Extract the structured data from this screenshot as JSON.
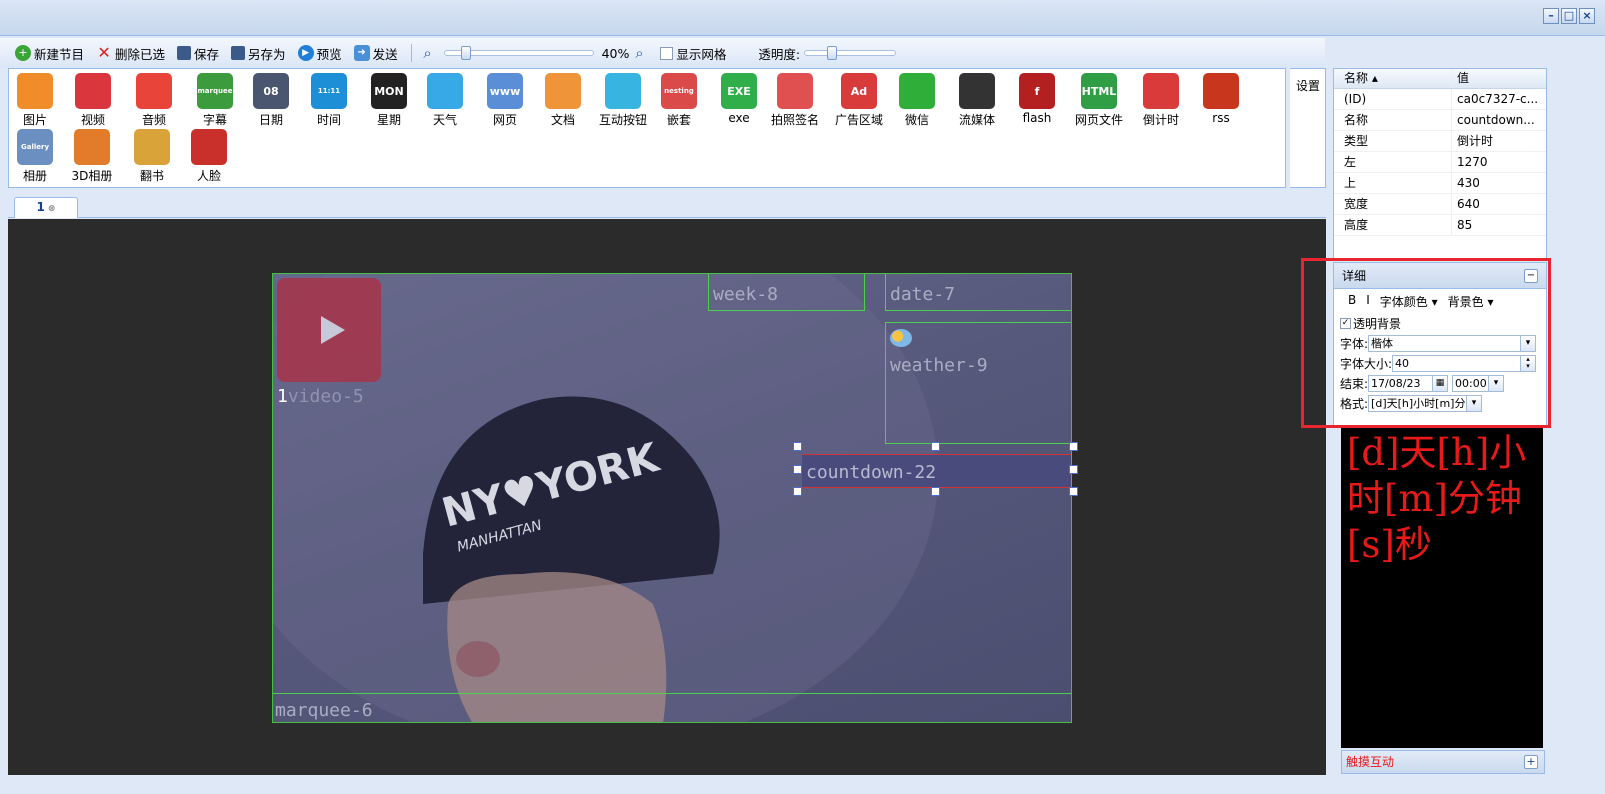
{
  "toolbar": {
    "new_program": "新建节目",
    "delete_selected": "删除已选",
    "save": "保存",
    "save_as": "另存为",
    "preview": "预览",
    "send": "发送",
    "zoom_value": "40%",
    "zoom_level": 0.4,
    "show_grid": "显示网格",
    "opacity": "透明度:"
  },
  "palette": {
    "settings": "设置",
    "items": [
      {
        "label": "图片",
        "icon": "picture-icon",
        "color": "#f08c2a"
      },
      {
        "label": "视频",
        "icon": "video-icon",
        "color": "#d9363e"
      },
      {
        "label": "音频",
        "icon": "audio-icon",
        "color": "#e8443a"
      },
      {
        "label": "字幕",
        "icon": "marquee-icon",
        "color": "#3c9b3c",
        "text": "marquee"
      },
      {
        "label": "日期",
        "icon": "date-icon",
        "color": "#4a5570",
        "text": "08"
      },
      {
        "label": "时间",
        "icon": "time-icon",
        "color": "#1c8fd6",
        "text": "11:11"
      },
      {
        "label": "星期",
        "icon": "week-icon",
        "color": "#222222",
        "text": "MON"
      },
      {
        "label": "天气",
        "icon": "weather-icon",
        "color": "#37a9e6"
      },
      {
        "label": "网页",
        "icon": "webpage-icon",
        "color": "#5a8fd8",
        "text": "www"
      },
      {
        "label": "文档",
        "icon": "document-icon",
        "color": "#f0943a"
      },
      {
        "label": "互动按钮",
        "icon": "interactive-button-icon",
        "color": "#38b4e0"
      },
      {
        "label": "嵌套",
        "icon": "nesting-icon",
        "color": "#d94a48",
        "text": "nesting"
      },
      {
        "label": "exe",
        "icon": "exe-icon",
        "color": "#2fae4a",
        "text": "EXE"
      },
      {
        "label": "拍照签名",
        "icon": "photo-signature-icon",
        "color": "#e05050"
      },
      {
        "label": "广告区域",
        "icon": "ad-icon",
        "color": "#d93a3a",
        "text": "Ad"
      },
      {
        "label": "微信",
        "icon": "wechat-icon",
        "color": "#2fae3a"
      },
      {
        "label": "流媒体",
        "icon": "streaming-icon",
        "color": "#333333"
      },
      {
        "label": "flash",
        "icon": "flash-icon",
        "color": "#b41f1f",
        "text": "f"
      },
      {
        "label": "网页文件",
        "icon": "html-icon",
        "color": "#2f9e44",
        "text": "HTML"
      },
      {
        "label": "倒计时",
        "icon": "countdown-icon",
        "color": "#d93a3a"
      },
      {
        "label": "rss",
        "icon": "rss-icon",
        "color": "#c9361e"
      },
      {
        "label": "相册",
        "icon": "album-icon",
        "color": "#6a8fc0",
        "text": "Gallery"
      },
      {
        "label": "3D相册",
        "icon": "3d-album-icon",
        "color": "#e27b2a"
      },
      {
        "label": "翻书",
        "icon": "flip-book-icon",
        "color": "#d9a33a"
      },
      {
        "label": "人脸",
        "icon": "face-icon",
        "color": "#c9302c"
      }
    ]
  },
  "tab": {
    "label": "1"
  },
  "canvas": {
    "regions": {
      "video": "video-5",
      "video_index": "1",
      "week": "week-8",
      "date": "date-7",
      "weather": "weather-9",
      "countdown": "countdown-22",
      "marquee": "marquee-6"
    }
  },
  "props": {
    "header_name": "名称",
    "header_value": "值",
    "rows": [
      {
        "k": "(ID)",
        "v": "ca0c7327-c..."
      },
      {
        "k": "名称",
        "v": "countdown..."
      },
      {
        "k": "类型",
        "v": "倒计时"
      },
      {
        "k": "左",
        "v": "1270"
      },
      {
        "k": "上",
        "v": "430"
      },
      {
        "k": "宽度",
        "v": "640"
      },
      {
        "k": "高度",
        "v": "85"
      }
    ]
  },
  "detail": {
    "title": "详细",
    "bold": "B",
    "italic": "I",
    "font_color": "字体颜色",
    "bg_color": "背景色",
    "transparent_bg": "透明背景",
    "font_label": "字体:",
    "font_value": "楷体",
    "font_size_label": "字体大小:",
    "font_size_value": "40",
    "end_label": "结束:",
    "end_date": "17/08/23",
    "end_time": "00:00",
    "format_label": "格式:",
    "format_value": "[d]天[h]小时[m]分钟"
  },
  "preview_text": "[d]天[h]小时[m]分钟[s]秒",
  "touch": {
    "label": "触摸互动"
  },
  "colors": {
    "accent_red": "#e8252e",
    "preview_text": "#e81919",
    "region_border": "#4ad04a"
  }
}
